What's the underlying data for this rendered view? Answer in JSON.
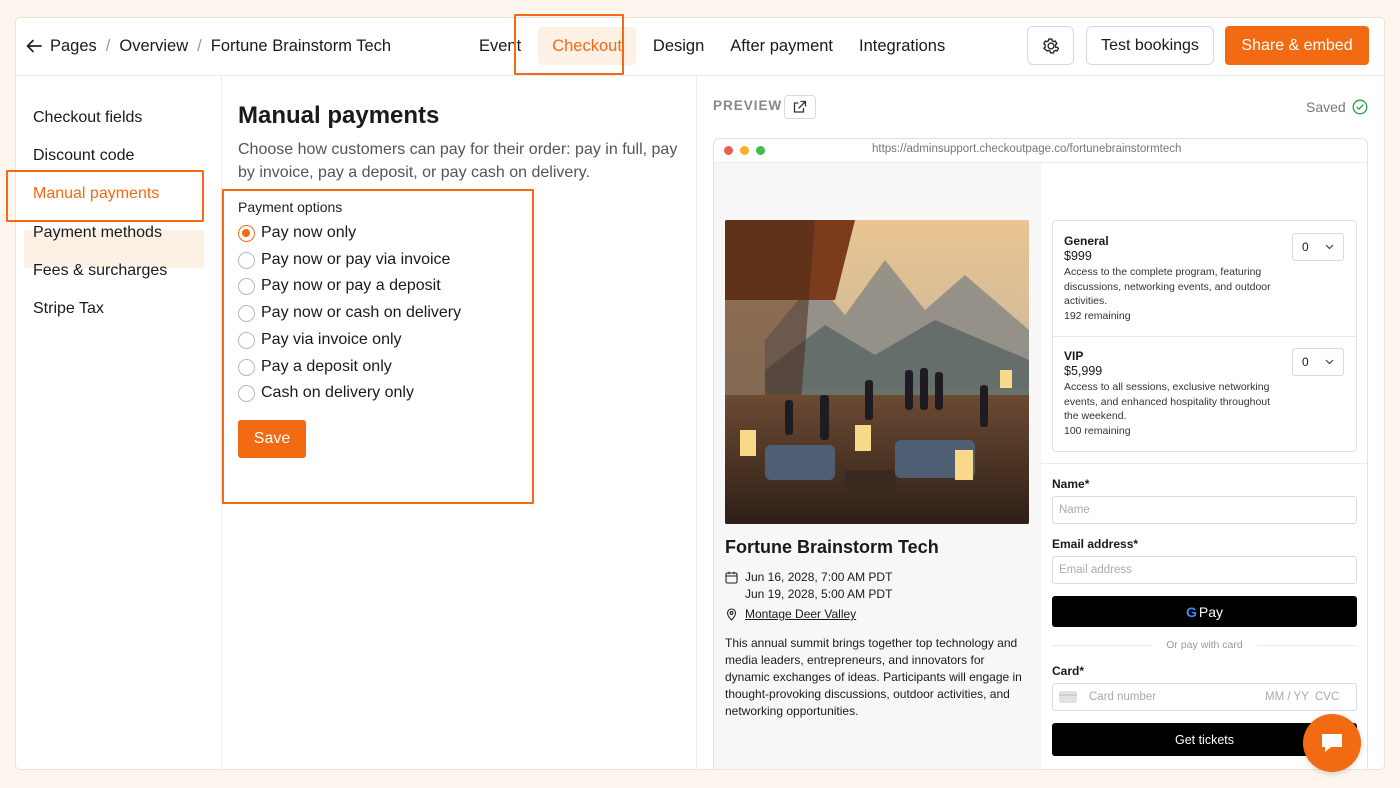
{
  "breadcrumb": {
    "pages": "Pages",
    "overview": "Overview",
    "event": "Fortune Brainstorm Tech"
  },
  "nav": {
    "event": "Event",
    "checkout": "Checkout",
    "design": "Design",
    "after_payment": "After payment",
    "integrations": "Integrations"
  },
  "actions": {
    "test_bookings": "Test bookings",
    "share_embed": "Share & embed"
  },
  "sidebar": {
    "items": [
      {
        "label": "Checkout fields"
      },
      {
        "label": "Discount code"
      },
      {
        "label": "Manual payments"
      },
      {
        "label": "Payment methods"
      },
      {
        "label": "Fees & surcharges"
      },
      {
        "label": "Stripe Tax"
      }
    ]
  },
  "main": {
    "title": "Manual payments",
    "description": "Choose how customers can pay for their order: pay in full, pay by invoice, pay a deposit, or pay cash on delivery.",
    "options_label": "Payment options",
    "options": [
      {
        "label": "Pay now only",
        "checked": true
      },
      {
        "label": "Pay now or pay via invoice",
        "checked": false
      },
      {
        "label": "Pay now or pay a deposit",
        "checked": false
      },
      {
        "label": "Pay now or cash on delivery",
        "checked": false
      },
      {
        "label": "Pay via invoice only",
        "checked": false
      },
      {
        "label": "Pay a deposit only",
        "checked": false
      },
      {
        "label": "Cash on delivery only",
        "checked": false
      }
    ],
    "save_label": "Save"
  },
  "preview": {
    "label": "PREVIEW",
    "status": "Saved",
    "url": "https://adminsupport.checkoutpage.co/fortunebrainstormtech",
    "event_title": "Fortune Brainstorm Tech",
    "date_start": "Jun 16, 2028, 7:00 AM PDT",
    "date_end": "Jun 19, 2028, 5:00 AM PDT",
    "location": "Montage Deer Valley",
    "description": "This annual summit brings together top technology and media leaders, entrepreneurs, and innovators for dynamic exchanges of ideas. Participants will engage in thought-provoking discussions, outdoor activities, and networking opportunities.",
    "tickets": [
      {
        "name": "General",
        "price": "$999",
        "desc": "Access to the complete program, featuring discussions, networking events, and outdoor activities.",
        "remaining": "192 remaining",
        "qty": "0"
      },
      {
        "name": "VIP",
        "price": "$5,999",
        "desc": "Access to all sessions, exclusive networking events, and enhanced hospitality throughout the weekend.",
        "remaining": "100 remaining",
        "qty": "0"
      }
    ],
    "form": {
      "name_label": "Name",
      "name_placeholder": "Name",
      "email_label": "Email address",
      "email_placeholder": "Email address",
      "gpay_label": "Pay",
      "or_text": "Or pay with card",
      "card_label": "Card",
      "card_placeholder": "Card number",
      "card_expiry": "MM / YY",
      "card_cvc": "CVC",
      "submit_label": "Get tickets"
    }
  },
  "colors": {
    "accent": "#f26a12",
    "accent_bg": "#fdf1e6",
    "page_bg": "#fdf6ee"
  }
}
